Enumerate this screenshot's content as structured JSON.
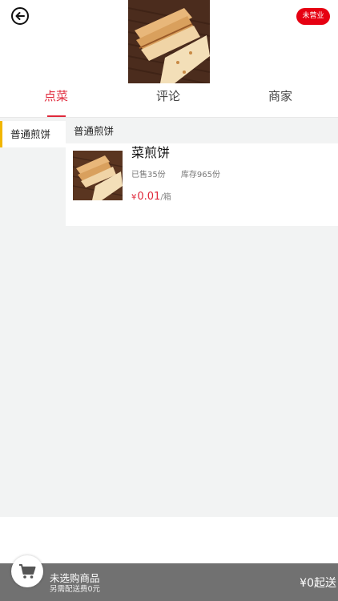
{
  "header": {
    "status_badge": "未营业",
    "hero_image": "fried-pancake-photo"
  },
  "tabs": [
    {
      "label": "点菜",
      "active": true
    },
    {
      "label": "评论",
      "active": false
    },
    {
      "label": "商家",
      "active": false
    }
  ],
  "sidebar": {
    "items": [
      {
        "label": "普通煎饼",
        "selected": true
      }
    ]
  },
  "menu": {
    "section_title": "普通煎饼",
    "dishes": [
      {
        "name": "菜煎饼",
        "sold": "已售35份",
        "stock": "库存965份",
        "currency": "¥",
        "price": "0.01",
        "unit": "/箱",
        "image": "fried-pancake-photo"
      }
    ]
  },
  "cart": {
    "title": "未选购商品",
    "delivery_note": "另需配送费0元",
    "min_order": "¥0起送"
  },
  "colors": {
    "accent_red": "#e0283a",
    "badge_red": "#e60012",
    "category_marker": "#f2b600",
    "cart_bar": "#717171",
    "main_bg": "#f2f3f3"
  },
  "icons": {
    "back": "back-arrow-icon",
    "cart": "shopping-cart-icon"
  }
}
